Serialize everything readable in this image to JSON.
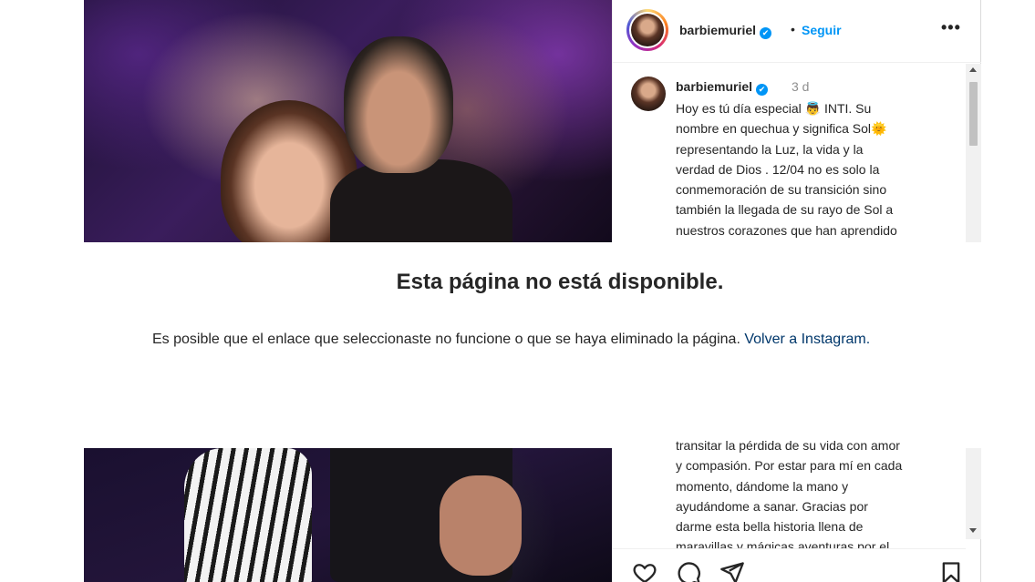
{
  "post": {
    "username": "barbiemuriel",
    "verified_glyph": "✔",
    "separator": "•",
    "follow_label": "Seguir",
    "more_label": "•••",
    "time": "3 d",
    "caption_top": "Hoy es tú día especial 👼 INTI. Su\nnombre en quechua y significa Sol🌞\nrepresentando la Luz, la vida y la\nverdad de Dios . 12/04 no es solo la\nconmemoración de su transición sino\ntambién la llegada de su rayo de Sol a\nnuestros corazones que han aprendido",
    "caption_bottom": "transitar la pérdida de su vida con amor\ny compasión. Por estar para mí en cada\nmomento, dándome la mano y\nayudándome a sanar. Gracias por\ndarme esta bella historia llena de\nmaravillas y mágicas aventuras por el"
  },
  "error": {
    "title": "Esta página no está disponible.",
    "message": "Es posible que el enlace que seleccionaste no funcione o que se haya eliminado la página. ",
    "link": "Volver a Instagram."
  },
  "icons": [
    "heart-icon",
    "comment-icon",
    "share-icon",
    "bookmark-icon",
    "more-icon",
    "verified-badge-icon"
  ],
  "colors": {
    "accent": "#0095f6",
    "link": "#00376b",
    "text": "#262626",
    "muted": "#8e8e8e"
  }
}
